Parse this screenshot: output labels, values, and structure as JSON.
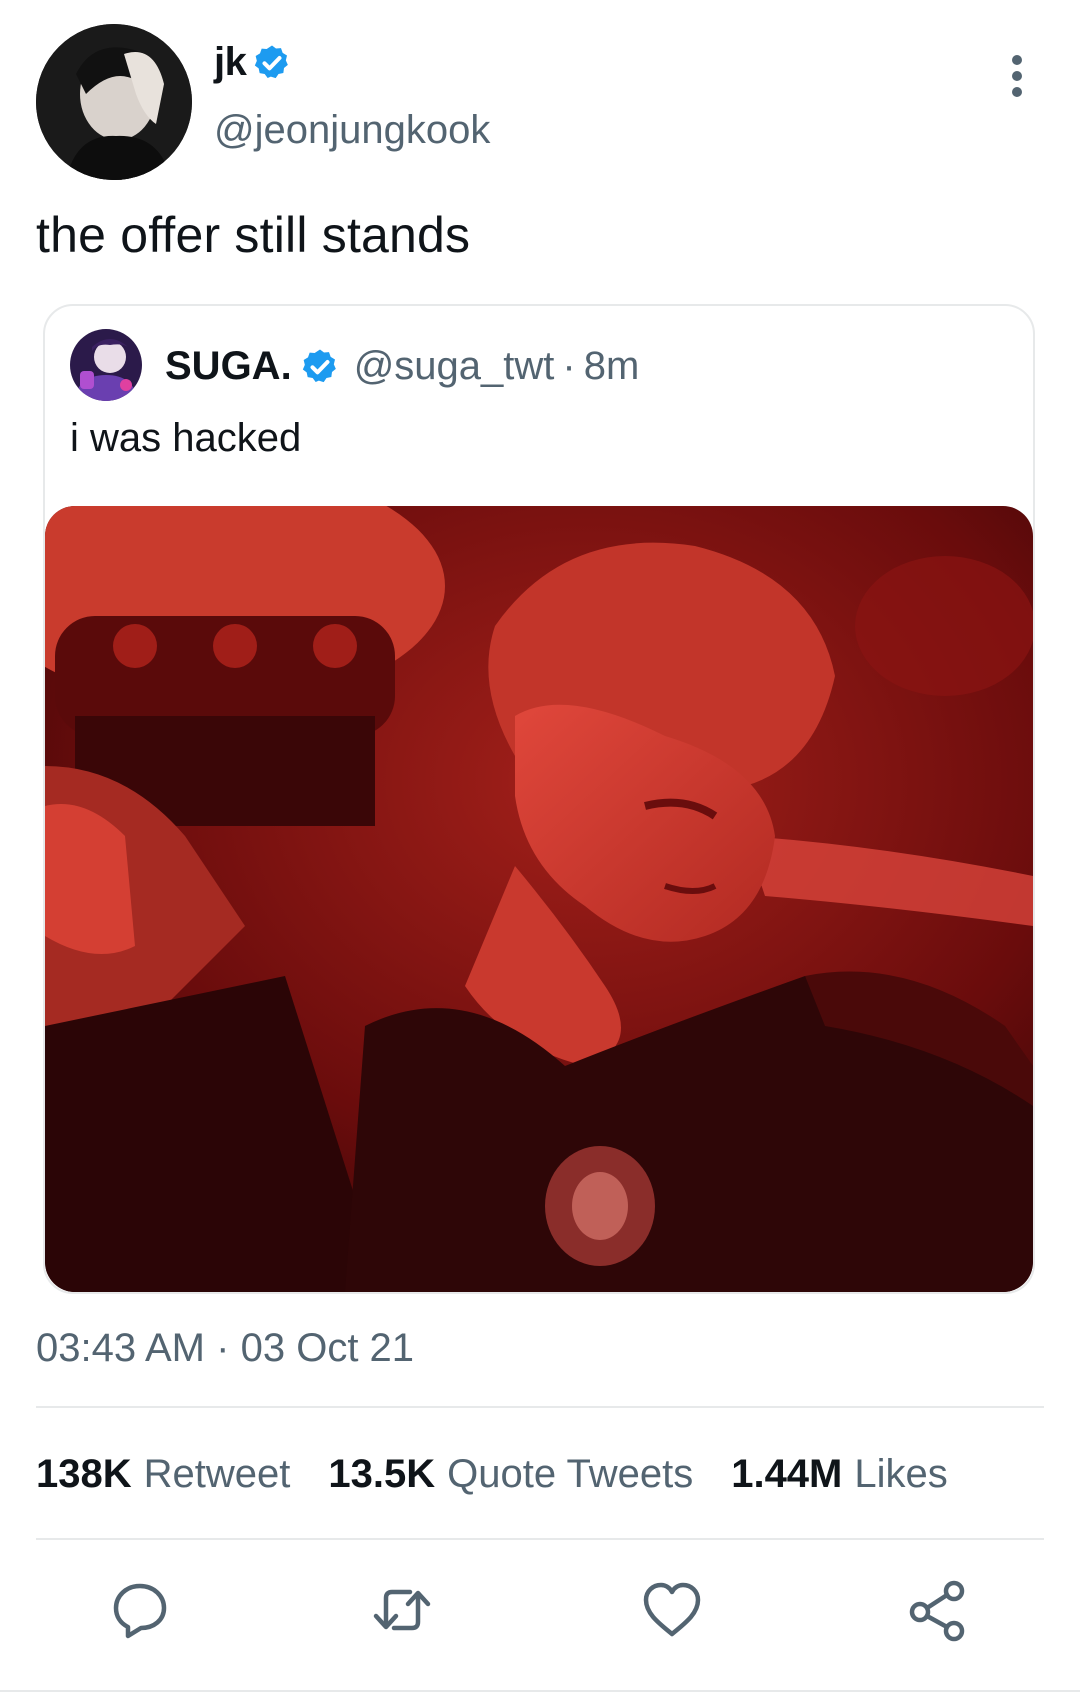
{
  "tweet": {
    "author": {
      "display_name": "jk",
      "handle": "@jeonjungkook",
      "verified": true
    },
    "text": "the offer still stands",
    "quoted_tweet": {
      "display_name": "SUGA.",
      "handle": "@suga_twt",
      "separator": "·",
      "relative_time": "8m",
      "verified": true,
      "text": "i was hacked"
    },
    "time": "03:43 AM",
    "separator": "·",
    "date": "03 Oct 21",
    "stats": [
      {
        "count": "138K",
        "label": "Retweet"
      },
      {
        "count": "13.5K",
        "label": "Quote Tweets"
      },
      {
        "count": "1.44M",
        "label": "Likes"
      }
    ]
  },
  "colors": {
    "verified_blue": "#1d9bf0",
    "secondary_text": "#536471",
    "divider": "#e7e9ea",
    "media_red": "#b01414"
  },
  "icons": {
    "more": "more-vertical-icon",
    "verified": "verified-badge-icon",
    "reply": "reply-icon",
    "retweet": "retweet-icon",
    "like": "heart-icon",
    "share": "share-icon"
  }
}
